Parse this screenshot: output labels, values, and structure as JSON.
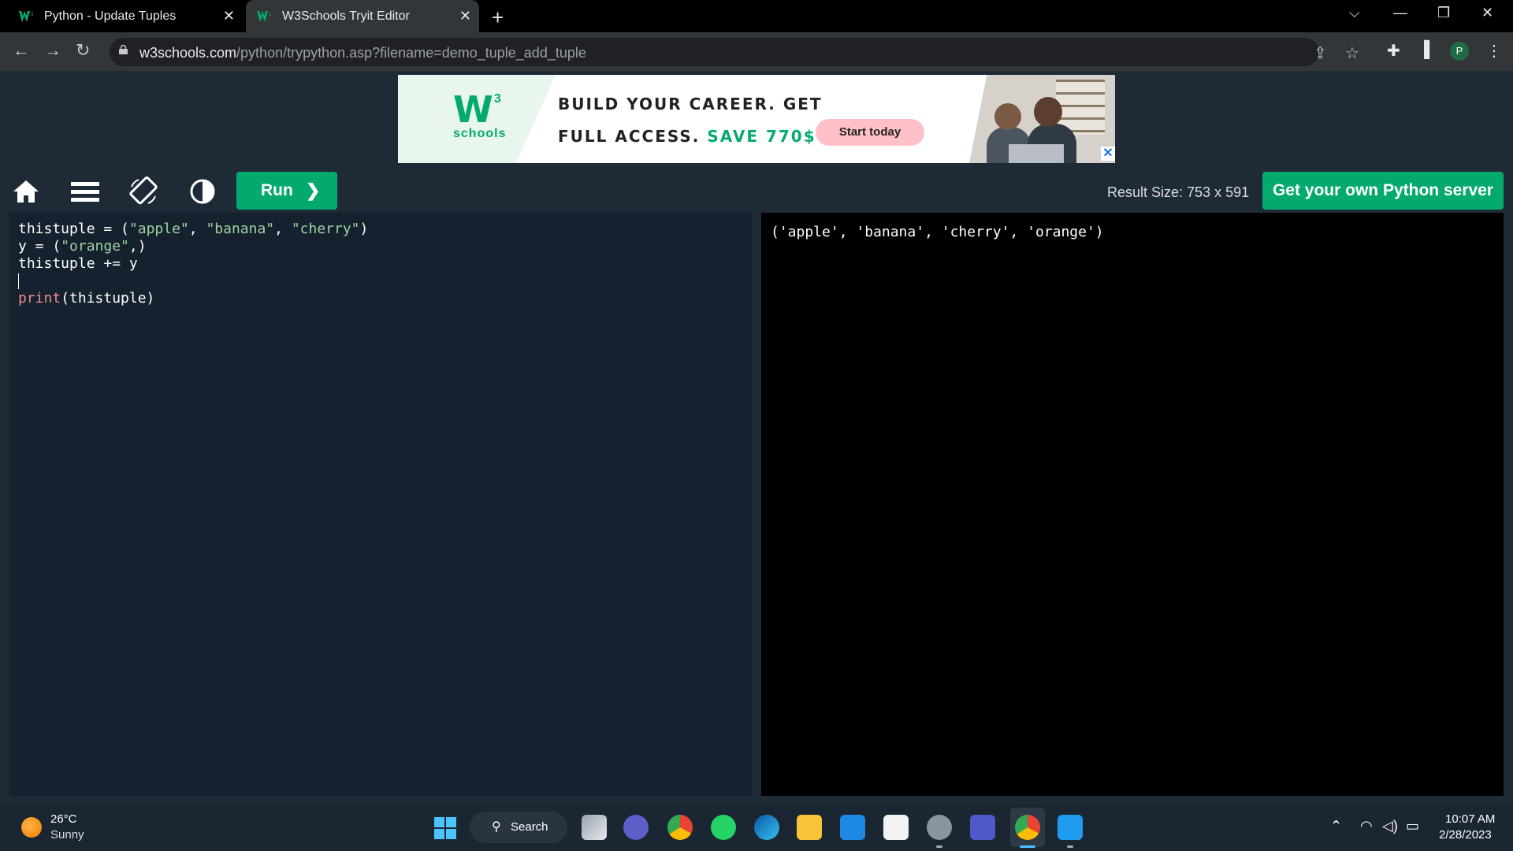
{
  "browser": {
    "tabs": [
      {
        "title": "Python - Update Tuples",
        "active": false
      },
      {
        "title": "W3Schools Tryit Editor",
        "active": true
      }
    ],
    "url_host": "w3schools.com",
    "url_path": "/python/trypython.asp?filename=demo_tuple_add_tuple",
    "profile_initial": "P"
  },
  "ad": {
    "logo_mark": "W",
    "logo_sup": "3",
    "logo_word": "schools",
    "line1": "BUILD YOUR CAREER. GET",
    "line2_prefix": "FULL ACCESS. ",
    "line2_highlight": "SAVE 770$",
    "cta": "Start today"
  },
  "toolbar": {
    "run_label": "Run",
    "result_size": "Result Size: 753 x 591",
    "server_button": "Get your own Python server"
  },
  "editor": {
    "lines": [
      [
        {
          "t": "thistuple = (",
          "c": ""
        },
        {
          "t": "\"apple\"",
          "c": "str"
        },
        {
          "t": ", ",
          "c": ""
        },
        {
          "t": "\"banana\"",
          "c": "str"
        },
        {
          "t": ", ",
          "c": ""
        },
        {
          "t": "\"cherry\"",
          "c": "str"
        },
        {
          "t": ")",
          "c": ""
        }
      ],
      [
        {
          "t": "y = (",
          "c": ""
        },
        {
          "t": "\"orange\"",
          "c": "str"
        },
        {
          "t": ",)",
          "c": ""
        }
      ],
      [
        {
          "t": "thistuple += y",
          "c": ""
        }
      ],
      [],
      [
        {
          "t": "print",
          "c": "kw"
        },
        {
          "t": "(thistuple)",
          "c": ""
        }
      ]
    ]
  },
  "result": {
    "output": "('apple', 'banana', 'cherry', 'orange')"
  },
  "taskbar": {
    "weather_temp": "26°C",
    "weather_condition": "Sunny",
    "search_label": "Search",
    "time": "10:07 AM",
    "date": "2/28/2023"
  },
  "colors": {
    "accent": "#04aa6d",
    "editor_bg": "#16212f",
    "page_bg": "#1f2a37"
  }
}
